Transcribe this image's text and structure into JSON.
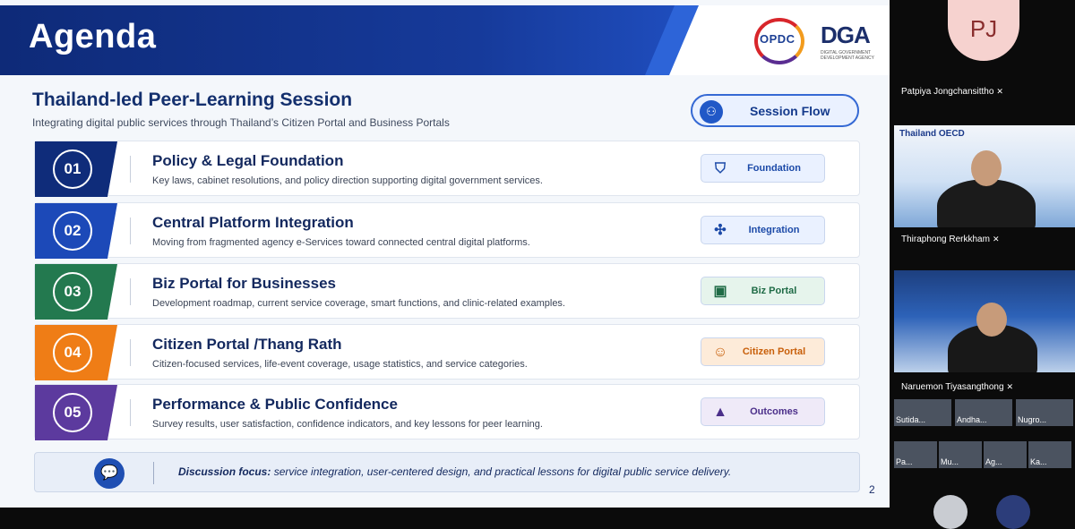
{
  "slide": {
    "title": "Agenda",
    "logos": {
      "opdc": "OPDC",
      "dga": "DGA",
      "dga_sub": "DIGITAL GOVERNMENT DEVELOPMENT AGENCY"
    },
    "session_title": "Thailand-led Peer-Learning Session",
    "session_subtitle": "Integrating digital public services through Thailand’s Citizen Portal and Business Portals",
    "session_flow_label": "Session Flow",
    "items": [
      {
        "num": "01",
        "title": "Policy & Legal Foundation",
        "desc": "Key laws, cabinet resolutions, and policy direction supporting digital government services.",
        "tag": "Foundation",
        "color": "#0f2c7a",
        "icon": "shield-icon",
        "tag_color": "#1c4aa8",
        "tag_bg": "#eaf1ff"
      },
      {
        "num": "02",
        "title": "Central Platform Integration",
        "desc": "Moving from fragmented agency e-Services toward connected central digital platforms.",
        "tag": "Integration",
        "color": "#1c49b8",
        "icon": "network-icon",
        "tag_color": "#1c4aa8",
        "tag_bg": "#eaf1ff"
      },
      {
        "num": "03",
        "title": "Biz Portal for Businesses",
        "desc": "Development roadmap, current service coverage, smart functions, and clinic-related examples.",
        "tag": "Biz Portal",
        "color": "#23794f",
        "icon": "briefcase-icon",
        "tag_color": "#1f6b46",
        "tag_bg": "#e6f4ec"
      },
      {
        "num": "04",
        "title": "Citizen Portal /Thang Rath",
        "desc": "Citizen-focused services, life-event coverage, usage statistics, and service categories.",
        "tag": "Citizen Portal",
        "color": "#ef7d16",
        "icon": "people-icon",
        "tag_color": "#c85f0a",
        "tag_bg": "#fdebd9"
      },
      {
        "num": "05",
        "title": "Performance & Public Confidence",
        "desc": "Survey results, user satisfaction, confidence indicators, and key lessons for peer learning.",
        "tag": "Outcomes",
        "color": "#5c3a9e",
        "icon": "chart-icon",
        "tag_color": "#4b2f8a",
        "tag_bg": "#efeaf8"
      }
    ],
    "discussion_label": "Discussion focus:",
    "discussion_text": "service integration, user-centered design, and practical lessons for digital public service delivery.",
    "page_number": "2"
  },
  "participants": {
    "top": {
      "initials": "PJ",
      "name": "Patpiya Jongchansittho"
    },
    "video1": {
      "name": "Thiraphong Rerkkham",
      "overlay": "Thailand OECD"
    },
    "video2": {
      "name": "Naruemon Tiyasangthong"
    },
    "thumbs": [
      {
        "name": "Sutida..."
      },
      {
        "name": "Andha..."
      },
      {
        "name": "Nugro..."
      },
      {
        "name": "Pa..."
      },
      {
        "name": "Mu..."
      },
      {
        "name": "Ag..."
      },
      {
        "name": "Ka..."
      }
    ]
  }
}
